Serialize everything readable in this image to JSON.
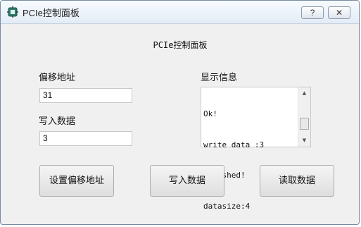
{
  "window": {
    "title": "PCIe控制面板",
    "help_label": "?",
    "close_label": "✕"
  },
  "panel": {
    "heading": "PCIe控制面板",
    "offset_label": "偏移地址",
    "offset_value": "31",
    "write_label": "写入数据",
    "write_value": "3",
    "info_label": "显示信息",
    "info_lines": [
      "Ok!",
      "write data :3",
      "finished!",
      "datasize:4"
    ],
    "scroll_up_label": "▲",
    "scroll_down_label": "▼"
  },
  "buttons": {
    "set_offset": "设置偏移地址",
    "write_data": "写入数据",
    "read_data": "读取数据"
  },
  "colors": {
    "window_bg": "#f0f0f0",
    "title_gradient_top": "#f7fbff",
    "button_border": "#adadad"
  },
  "icons": {
    "app": "circuit-board-icon",
    "help": "question-icon",
    "close": "close-icon"
  }
}
